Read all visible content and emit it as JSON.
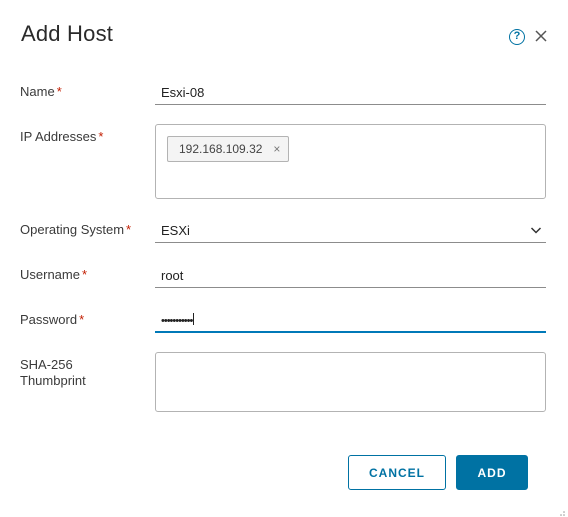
{
  "dialog": {
    "title": "Add Host",
    "help_icon": "help-circle-icon",
    "close_icon": "close-icon"
  },
  "form": {
    "required_marker": "*",
    "name": {
      "label": "Name",
      "value": "Esxi-08"
    },
    "ip_addresses": {
      "label": "IP Addresses",
      "chips": [
        {
          "value": "192.168.109.32",
          "remove": "×"
        }
      ]
    },
    "operating_system": {
      "label": "Operating System",
      "value": "ESXi",
      "icon": "chevron-down-icon"
    },
    "username": {
      "label": "Username",
      "value": "root"
    },
    "password": {
      "label": "Password",
      "value": "•••••••••••"
    },
    "thumbprint": {
      "label_line1": "SHA-256",
      "label_line2": "Thumbprint",
      "value": ""
    }
  },
  "footer": {
    "cancel_label": "CANCEL",
    "add_label": "ADD"
  },
  "colors": {
    "accent": "#0072a3",
    "required": "#c21d00"
  }
}
